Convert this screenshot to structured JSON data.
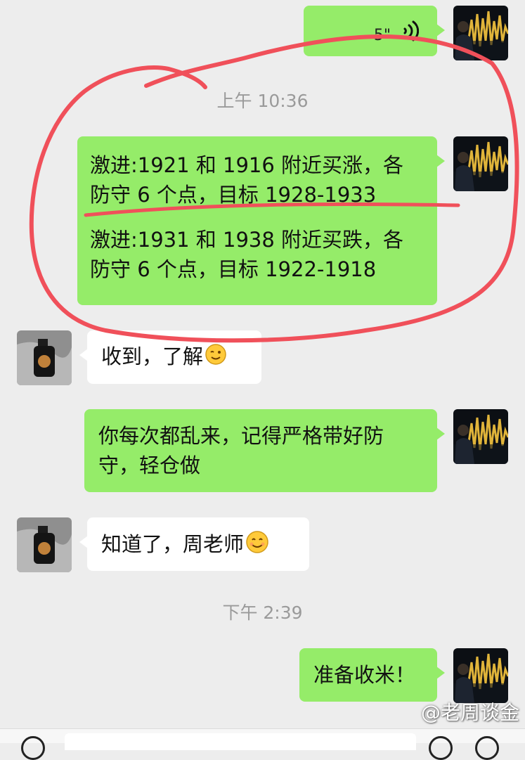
{
  "chat": {
    "voice_message": {
      "duration": "5\""
    },
    "time_morning": "上午 10:36",
    "signal_message": {
      "paragraph1": "激进:1921 和 1916 附近买涨，各\n防守 6 个点，目标 1928-1933",
      "paragraph2": "激进:1931 和 1938 附近买跌，各\n防守 6 个点，目标 1922-1918"
    },
    "reply_received": "收到，了解",
    "teacher_warning": "你每次都乱来，记得严格带好防\n守，轻仓做",
    "reply_know": "知道了，周老师",
    "time_afternoon": "下午 2:39",
    "prepare_close": "准备收米！"
  },
  "watermark": "@老周谈金",
  "colors": {
    "background": "#ededed",
    "sent_bubble": "#95ec69",
    "received_bubble": "#ffffff",
    "annotation": "#f0505a",
    "timestamp": "#9a9a9a"
  },
  "icons": {
    "voice": "voice-wave-icon",
    "emoji_wink": "wink-emoji-icon",
    "emoji_smile": "smile-emoji-icon",
    "voice_input": "voice-input-icon",
    "emoji_input": "emoji-input-icon",
    "add": "add-icon"
  }
}
